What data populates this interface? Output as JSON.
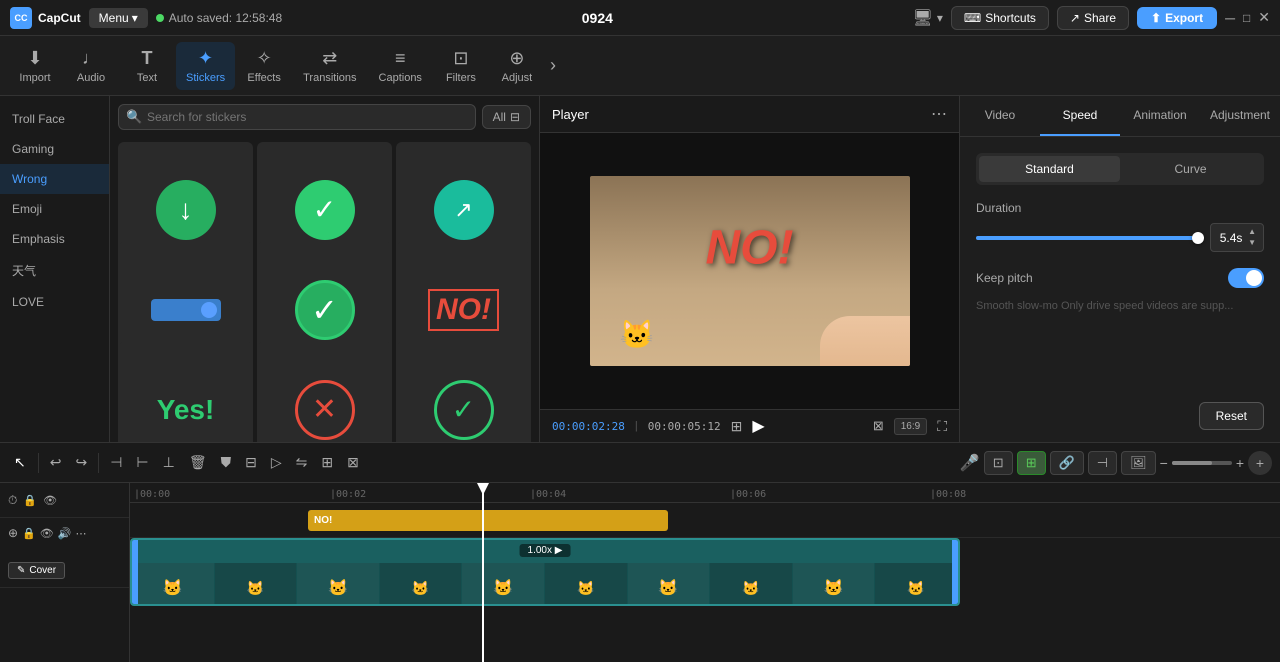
{
  "app": {
    "logo": "CC",
    "name": "CapCut",
    "menu_label": "Menu",
    "menu_arrow": "▾"
  },
  "top_bar": {
    "auto_saved": "Auto saved: 12:58:48",
    "title": "0924",
    "shortcuts_label": "Shortcuts",
    "share_label": "Share",
    "export_label": "Export"
  },
  "toolbar": {
    "items": [
      {
        "id": "import",
        "label": "Import",
        "icon": "⬇"
      },
      {
        "id": "audio",
        "label": "Audio",
        "icon": "♪"
      },
      {
        "id": "text",
        "label": "Text",
        "icon": "T"
      },
      {
        "id": "stickers",
        "label": "Stickers",
        "icon": "✦",
        "active": true
      },
      {
        "id": "effects",
        "label": "Effects",
        "icon": "✧"
      },
      {
        "id": "transitions",
        "label": "Transitions",
        "icon": "⇄"
      },
      {
        "id": "captions",
        "label": "Captions",
        "icon": "≡"
      },
      {
        "id": "filters",
        "label": "Filters",
        "icon": "⊡"
      },
      {
        "id": "adjust",
        "label": "Adjust",
        "icon": "⊕"
      }
    ],
    "more_icon": "›"
  },
  "sidebar": {
    "items": [
      {
        "id": "troll-face",
        "label": "Troll Face",
        "active": false
      },
      {
        "id": "gaming",
        "label": "Gaming",
        "active": false
      },
      {
        "id": "wrong",
        "label": "Wrong",
        "active": true
      },
      {
        "id": "emoji",
        "label": "Emoji",
        "active": false
      },
      {
        "id": "emphasis",
        "label": "Emphasis",
        "active": false
      },
      {
        "id": "weather",
        "label": "天气",
        "active": false
      },
      {
        "id": "love",
        "label": "LOVE",
        "active": false
      }
    ]
  },
  "sticker_panel": {
    "search_placeholder": "Search for stickers",
    "filter_label": "All",
    "filter_icon": "⊟"
  },
  "player": {
    "title": "Player",
    "menu_icon": "⋯",
    "time_current": "00:00:02:28",
    "time_total": "00:00:05:12",
    "no_text": "NO!",
    "aspect_ratio": "16:9",
    "play_icon": "▶"
  },
  "right_panel": {
    "tabs": [
      {
        "id": "video",
        "label": "Video"
      },
      {
        "id": "speed",
        "label": "Speed",
        "active": true
      },
      {
        "id": "animation",
        "label": "Animation"
      },
      {
        "id": "adjustment",
        "label": "Adjustment"
      }
    ],
    "speed": {
      "type_standard": "Standard",
      "type_curve": "Curve",
      "duration_label": "Duration",
      "duration_value": "5.4s",
      "duration_unit": "s",
      "keep_pitch_label": "Keep pitch",
      "smooth_slowmo": "Smooth slow-mo Only drive speed videos are supp...",
      "reset_label": "Reset"
    }
  },
  "timeline": {
    "ruler_marks": [
      "00:00",
      "|00:02",
      "|00:04",
      "|00:06",
      "|00:08"
    ],
    "sticker_clip_label": "NO!",
    "speed_label": "1.00x ▶",
    "cover_label": "Cover",
    "edit_icon": "✎",
    "mic_icon": "🎤",
    "track_icons": {
      "lock": "🔒",
      "eye": "👁",
      "speaker": "🔊",
      "more": "⋯",
      "clock": "⏱",
      "layers": "⊕"
    }
  },
  "tl_tools": [
    {
      "id": "select",
      "icon": "↖",
      "active": true
    },
    {
      "id": "undo",
      "icon": "↩"
    },
    {
      "id": "redo",
      "icon": "↪"
    },
    {
      "id": "split-h",
      "icon": "⊢"
    },
    {
      "id": "split-v",
      "icon": "⊣"
    },
    {
      "id": "split-both",
      "icon": "⊥"
    },
    {
      "id": "delete",
      "icon": "🗑"
    },
    {
      "id": "shield",
      "icon": "⛊"
    },
    {
      "id": "transform",
      "icon": "⊟"
    },
    {
      "id": "play",
      "icon": "▷"
    },
    {
      "id": "mirror",
      "icon": "⇋"
    },
    {
      "id": "crop",
      "icon": "⊞"
    },
    {
      "id": "frame",
      "icon": "⊠"
    }
  ]
}
